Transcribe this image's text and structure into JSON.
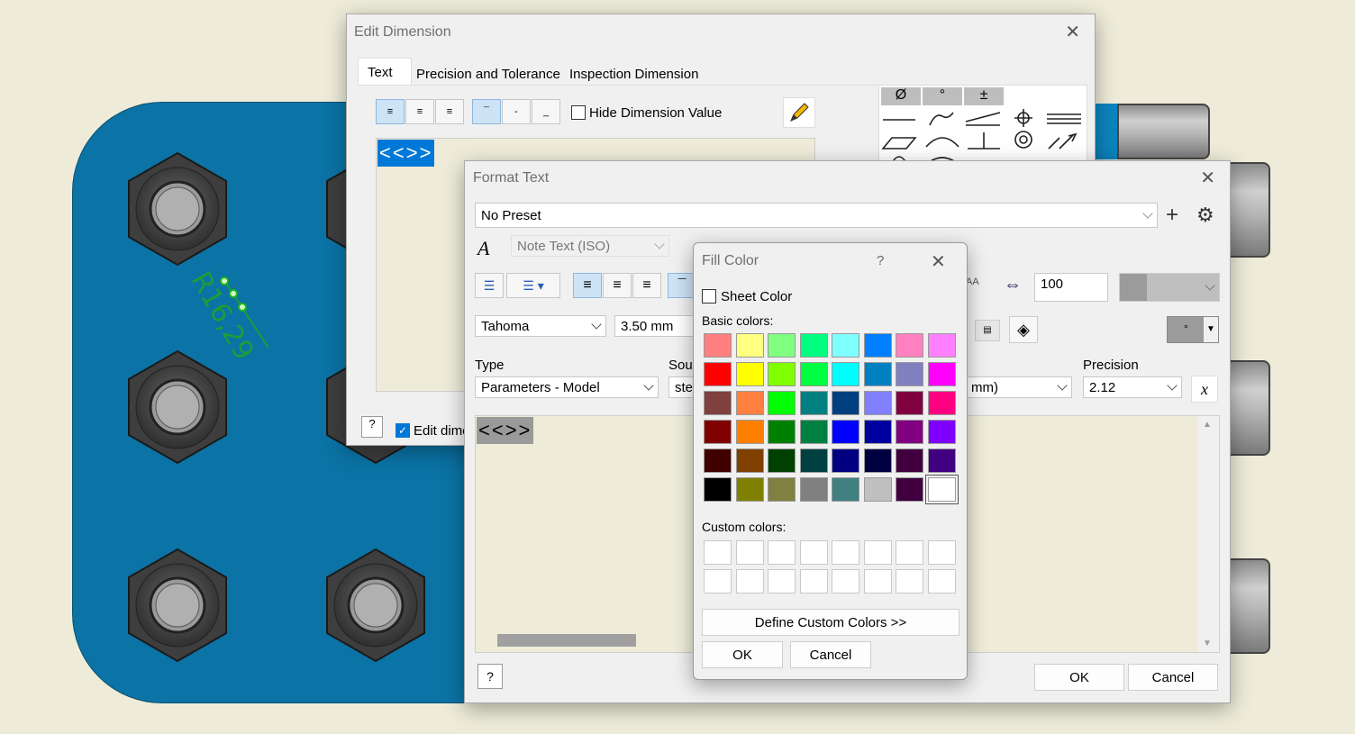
{
  "edit_dimension": {
    "title": "Edit Dimension",
    "tabs": [
      "Text",
      "Precision and Tolerance",
      "Inspection Dimension"
    ],
    "hide_value_label": "Hide Dimension Value",
    "value_token": "<<>>",
    "edit_dim_label": "Edit dime",
    "symbol_tabs": [
      "Ø",
      "°",
      "±"
    ]
  },
  "format_text": {
    "title": "Format Text",
    "preset": "No Preset",
    "style": "Note Text (ISO)",
    "font": "Tahoma",
    "size": "3.50 mm",
    "type_label": "Type",
    "type_value": "Parameters - Model",
    "source_label": "Sour",
    "source_value": "stee",
    "units_value": "mm)",
    "precision_label": "Precision",
    "precision_value": "2.12",
    "stretch_value": "100",
    "text_token": "<<>>",
    "ok": "OK",
    "cancel": "Cancel"
  },
  "fill_color": {
    "title": "Fill Color",
    "help": "?",
    "sheet_color_label": "Sheet Color",
    "basic_label": "Basic colors:",
    "custom_label": "Custom colors:",
    "define_label": "Define Custom Colors >>",
    "ok": "OK",
    "cancel": "Cancel",
    "basic_colors": [
      "#ff8080",
      "#ffff80",
      "#80ff80",
      "#00ff80",
      "#80ffff",
      "#0080ff",
      "#ff80c0",
      "#ff80ff",
      "#ff0000",
      "#ffff00",
      "#80ff00",
      "#00ff40",
      "#00ffff",
      "#0080c0",
      "#8080c0",
      "#ff00ff",
      "#804040",
      "#ff8040",
      "#00ff00",
      "#008080",
      "#004080",
      "#8080ff",
      "#800040",
      "#ff0080",
      "#800000",
      "#ff8000",
      "#008000",
      "#008040",
      "#0000ff",
      "#0000a0",
      "#800080",
      "#8000ff",
      "#400000",
      "#804000",
      "#004000",
      "#004040",
      "#000080",
      "#000040",
      "#400040",
      "#400080",
      "#000000",
      "#808000",
      "#808040",
      "#808080",
      "#408080",
      "#c0c0c0",
      "#400040",
      "#ffffff"
    ]
  },
  "canvas": {
    "dimension_label": "R16,29"
  }
}
